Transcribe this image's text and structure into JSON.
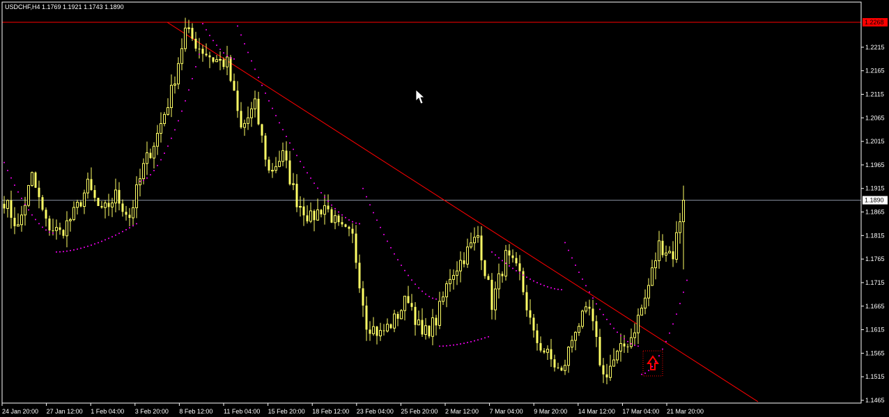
{
  "chart_data": {
    "type": "candlestick",
    "title": "USDCHF,H4  1.1769 1.1921 1.1743 1.1890",
    "symbol": "USDCHF",
    "timeframe": "H4",
    "ohlc_header": {
      "open": 1.1769,
      "high": 1.1921,
      "low": 1.1743,
      "close": 1.189
    },
    "ylim": [
      1.1465,
      1.2268
    ],
    "y_ticks": [
      1.2215,
      1.2165,
      1.2115,
      1.2065,
      1.2015,
      1.1965,
      1.1915,
      1.1865,
      1.1815,
      1.1765,
      1.1715,
      1.1665,
      1.1615,
      1.1565,
      1.1515,
      1.1465
    ],
    "y_tick_labels": [
      "1.2215",
      "1.2165",
      "1.2115",
      "1.2065",
      "1.2015",
      "1.1965",
      "1.1915",
      "1.1865",
      "1.1815",
      "1.1765",
      "1.1715",
      "1.1665",
      "1.1615",
      "1.1565",
      "1.1515",
      "1.1465"
    ],
    "x_tick_labels": [
      "24 Jan 20:00",
      "27 Jan 12:00",
      "1 Feb 04:00",
      "3 Feb 20:00",
      "8 Feb 12:00",
      "11 Feb 04:00",
      "15 Feb 20:00",
      "18 Feb 12:00",
      "23 Feb 04:00",
      "25 Feb 20:00",
      "2 Mar 12:00",
      "7 Mar 04:00",
      "9 Mar 20:00",
      "14 Mar 12:00",
      "17 Mar 04:00",
      "21 Mar 20:00"
    ],
    "resistance_level": {
      "value": 1.2268,
      "label": "1.2268",
      "color": "#ff0000"
    },
    "current_price": {
      "value": 1.189,
      "label": "1.1890",
      "color": "#8a93a3"
    },
    "trendline": {
      "start": {
        "bar": 0,
        "price": 1.2268
      },
      "end": {
        "bar": 216,
        "price": 1.1462
      },
      "color": "#ff0000"
    },
    "grid": false,
    "candle_color": "#ffff66",
    "sar_color": "#ff00ff",
    "background": "#000000",
    "arrow_signal": {
      "type": "up-arrow",
      "color": "#ff0000"
    },
    "price_waypoints": [
      [
        0,
        1.189
      ],
      [
        4,
        1.183
      ],
      [
        8,
        1.194
      ],
      [
        12,
        1.184
      ],
      [
        16,
        1.182
      ],
      [
        20,
        1.186
      ],
      [
        24,
        1.192
      ],
      [
        28,
        1.186
      ],
      [
        32,
        1.19
      ],
      [
        36,
        1.1855
      ],
      [
        40,
        1.196
      ],
      [
        44,
        1.203
      ],
      [
        48,
        1.212
      ],
      [
        52,
        1.225
      ],
      [
        56,
        1.2215
      ],
      [
        60,
        1.219
      ],
      [
        64,
        1.218
      ],
      [
        68,
        1.204
      ],
      [
        72,
        1.209
      ],
      [
        76,
        1.195
      ],
      [
        80,
        1.1985
      ],
      [
        84,
        1.189
      ],
      [
        88,
        1.185
      ],
      [
        92,
        1.188
      ],
      [
        96,
        1.183
      ],
      [
        100,
        1.181
      ],
      [
        104,
        1.163
      ],
      [
        108,
        1.1605
      ],
      [
        112,
        1.1635
      ],
      [
        116,
        1.1685
      ],
      [
        120,
        1.16
      ],
      [
        124,
        1.1635
      ],
      [
        128,
        1.173
      ],
      [
        132,
        1.177
      ],
      [
        136,
        1.1815
      ],
      [
        140,
        1.167
      ],
      [
        144,
        1.177
      ],
      [
        148,
        1.173
      ],
      [
        152,
        1.16
      ],
      [
        156,
        1.156
      ],
      [
        160,
        1.152
      ],
      [
        164,
        1.162
      ],
      [
        168,
        1.1655
      ],
      [
        172,
        1.1515
      ],
      [
        176,
        1.156
      ],
      [
        180,
        1.16
      ],
      [
        184,
        1.168
      ],
      [
        188,
        1.1795
      ],
      [
        192,
        1.1775
      ],
      [
        195,
        1.189
      ]
    ],
    "sar_segments": [
      {
        "from": 0,
        "to": 14,
        "start": 1.197,
        "accel": -1,
        "base": 1.182
      },
      {
        "from": 15,
        "to": 38,
        "start": 1.178,
        "accel": 1,
        "peak": 1.184
      },
      {
        "from": 39,
        "to": 56,
        "start": 1.193,
        "accel": 1,
        "peak": 1.22
      },
      {
        "from": 57,
        "to": 66,
        "start": 1.2265,
        "accel": -1,
        "base": 1.219
      },
      {
        "from": 67,
        "to": 102,
        "start": 1.226,
        "accel": -1,
        "base": 1.184
      },
      {
        "from": 103,
        "to": 124,
        "start": 1.1915,
        "accel": -1,
        "base": 1.168
      },
      {
        "from": 125,
        "to": 139,
        "start": 1.158,
        "accel": 1,
        "peak": 1.16
      },
      {
        "from": 140,
        "to": 160,
        "start": 1.178,
        "accel": -1,
        "base": 1.17
      },
      {
        "from": 161,
        "to": 182,
        "start": 1.18,
        "accel": -1,
        "base": 1.158
      },
      {
        "from": 183,
        "to": 196,
        "start": 1.152,
        "accel": 1,
        "peak": 1.172
      }
    ]
  }
}
